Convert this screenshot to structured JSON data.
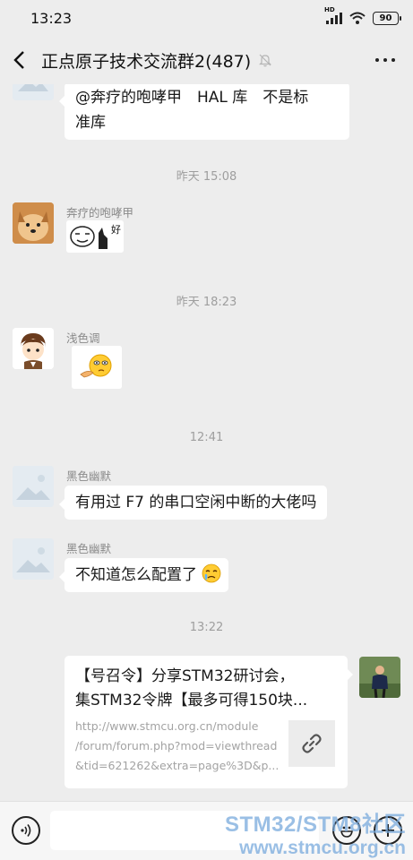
{
  "status_bar": {
    "time": "13:23",
    "network_label": "HD",
    "battery": "90"
  },
  "header": {
    "title": "正点原子技术交流群2(487)"
  },
  "messages": {
    "m1": {
      "text_line1": "@奔疗的咆哮甲　HAL 库　不是标",
      "text_line2": "准库"
    },
    "t1": "昨天 15:08",
    "m2": {
      "sender": "奔疗的咆哮甲",
      "sticker_text": "好"
    },
    "t2": "昨天 18:23",
    "m3": {
      "sender": "浅色调"
    },
    "t3": "12:41",
    "m4": {
      "sender": "黑色幽默",
      "text": "有用过 F7 的串口空闲中断的大佬吗"
    },
    "m5": {
      "sender": "黑色幽默",
      "text": "不知道怎么配置了"
    },
    "t4": "13:22",
    "m6": {
      "title_line1": "【号召令】分享STM32研讨会，",
      "title_line2": "集STM32令牌【最多可得150块...",
      "desc_line1": "http://www.stmcu.org.cn/module",
      "desc_line2": "/forum/forum.php?mod=viewthread",
      "desc_line3": "&tid=621262&extra=page%3D&p..."
    }
  },
  "watermark": {
    "line1": "STM32/STM8社区",
    "line2": "www.stmcu.org.cn"
  },
  "colors": {
    "background": "#ededed",
    "bubble": "#ffffff",
    "timestamp": "#9e9e9e",
    "sender": "#8a8a8a"
  }
}
